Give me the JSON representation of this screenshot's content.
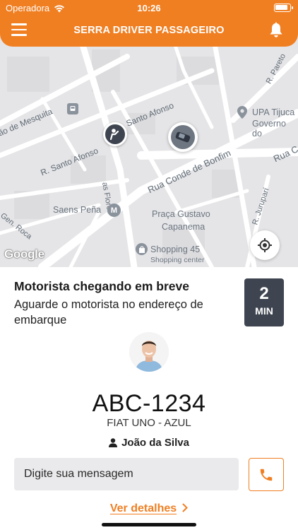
{
  "status_bar": {
    "carrier": "Operadora",
    "time": "10:26"
  },
  "header": {
    "title": "SERRA DRIVER PASSAGEIRO",
    "menu_icon": "hamburger-menu-icon",
    "notification_icon": "bell-icon"
  },
  "map": {
    "streets": [
      "ão de Mesquita",
      "R. Santo Afonso",
      "R. Santo Afonso",
      "Rua Conde de Bonfim",
      "Rua C",
      "as Flores",
      "Gen. Roca",
      "R. Pareto",
      "R. Juruparí"
    ],
    "places": [
      "Saens Peña",
      "Praça Gustavo",
      "Capanema",
      "UPA Tijuca",
      "Governo do",
      "Shopping 45",
      "Shopping center"
    ],
    "logo": "Google",
    "locate_icon": "crosshair-icon"
  },
  "ride": {
    "status_title": "Motorista chegando em breve",
    "status_subtitle": "Aguarde o motorista no endereço de embarque",
    "eta_value": "2",
    "eta_unit": "MIN",
    "plate": "ABC-1234",
    "car_model": "FIAT UNO - AZUL",
    "driver_name": "João da Silva"
  },
  "message": {
    "placeholder": "Digite sua mensagem"
  },
  "actions": {
    "details_label": "Ver detalhes"
  },
  "colors": {
    "brand": "#f07f22",
    "eta_box": "#3e4550",
    "map_bg": "#e6e6e8"
  }
}
